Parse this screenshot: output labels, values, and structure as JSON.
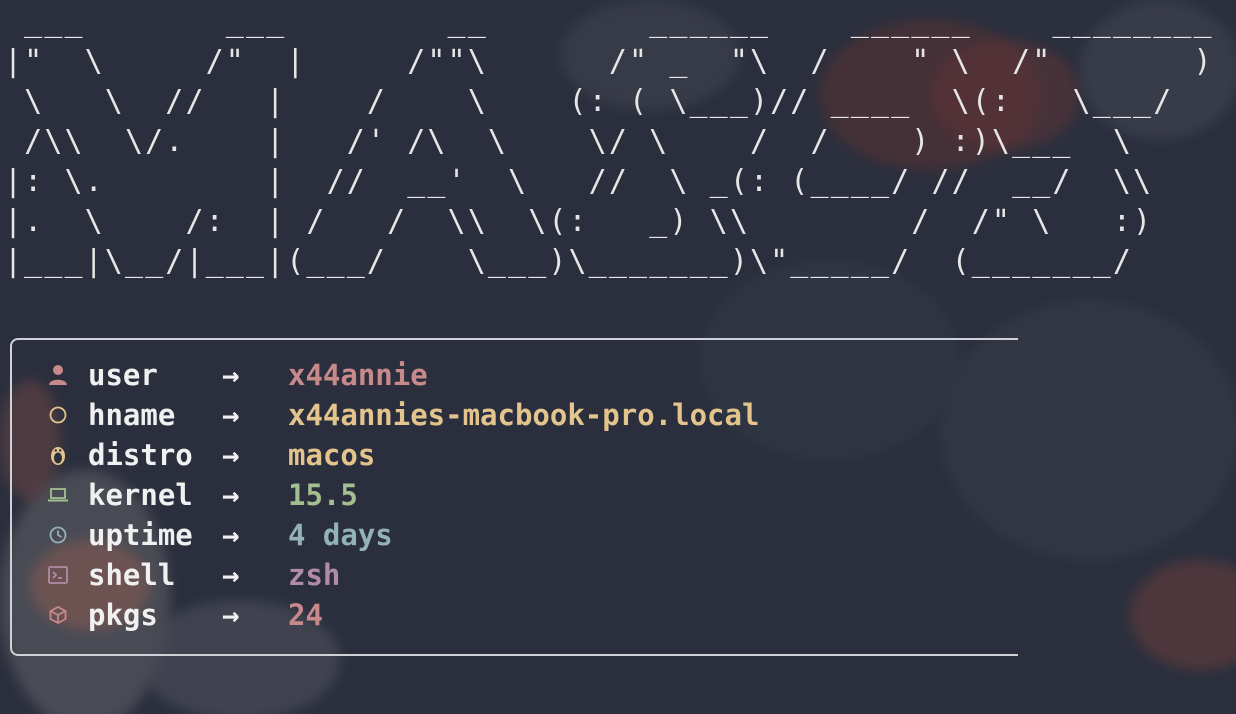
{
  "ascii_banner": " ___       ___        __        ______    ______    ________\n|\"  \\     /\"  |     /\"\"\\      /\" _  \"\\  /    \" \\  /\"       )\n \\   \\  //   |    /    \\    (: ( \\___)// ____  \\(:   \\___/\n /\\\\  \\/.    |   /' /\\  \\    \\/ \\    /  /    ) :)\\___  \\\n|: \\.        |  //  __'  \\   //  \\ _(: (____/ //  __/  \\\\\n|.  \\    /:  | /   /  \\\\  \\(:   _) \\\\        /  /\" \\   :)\n|___|\\__/|___|(___/    \\___)\\_______)\\\"_____/  (_______/",
  "info": {
    "arrow": "→",
    "rows": [
      {
        "label": "user",
        "value": "x44annie",
        "icon": "user-icon",
        "value_color": "#c8898b",
        "icon_color": "#c8898b"
      },
      {
        "label": "hname",
        "value": "x44annies-macbook-pro.local",
        "icon": "circle-icon",
        "value_color": "#e3c48c",
        "icon_color": "#e3c48c"
      },
      {
        "label": "distro",
        "value": "macos",
        "icon": "penguin-icon",
        "value_color": "#e3c48c",
        "icon_color": "#e3c48c"
      },
      {
        "label": "kernel",
        "value": "15.5",
        "icon": "laptop-icon",
        "value_color": "#a3bf90",
        "icon_color": "#a3bf90"
      },
      {
        "label": "uptime",
        "value": "4 days",
        "icon": "clock-icon",
        "value_color": "#92b2b5",
        "icon_color": "#92b2b5"
      },
      {
        "label": "shell",
        "value": "zsh",
        "icon": "terminal-icon",
        "value_color": "#b18ca6",
        "icon_color": "#b18ca6"
      },
      {
        "label": "pkgs",
        "value": "24",
        "icon": "package-icon",
        "value_color": "#c8898b",
        "icon_color": "#c8898b"
      }
    ]
  },
  "colors": {
    "background": "#2b2f3d",
    "text": "#f0f0f0",
    "border": "#cfd1d6"
  }
}
